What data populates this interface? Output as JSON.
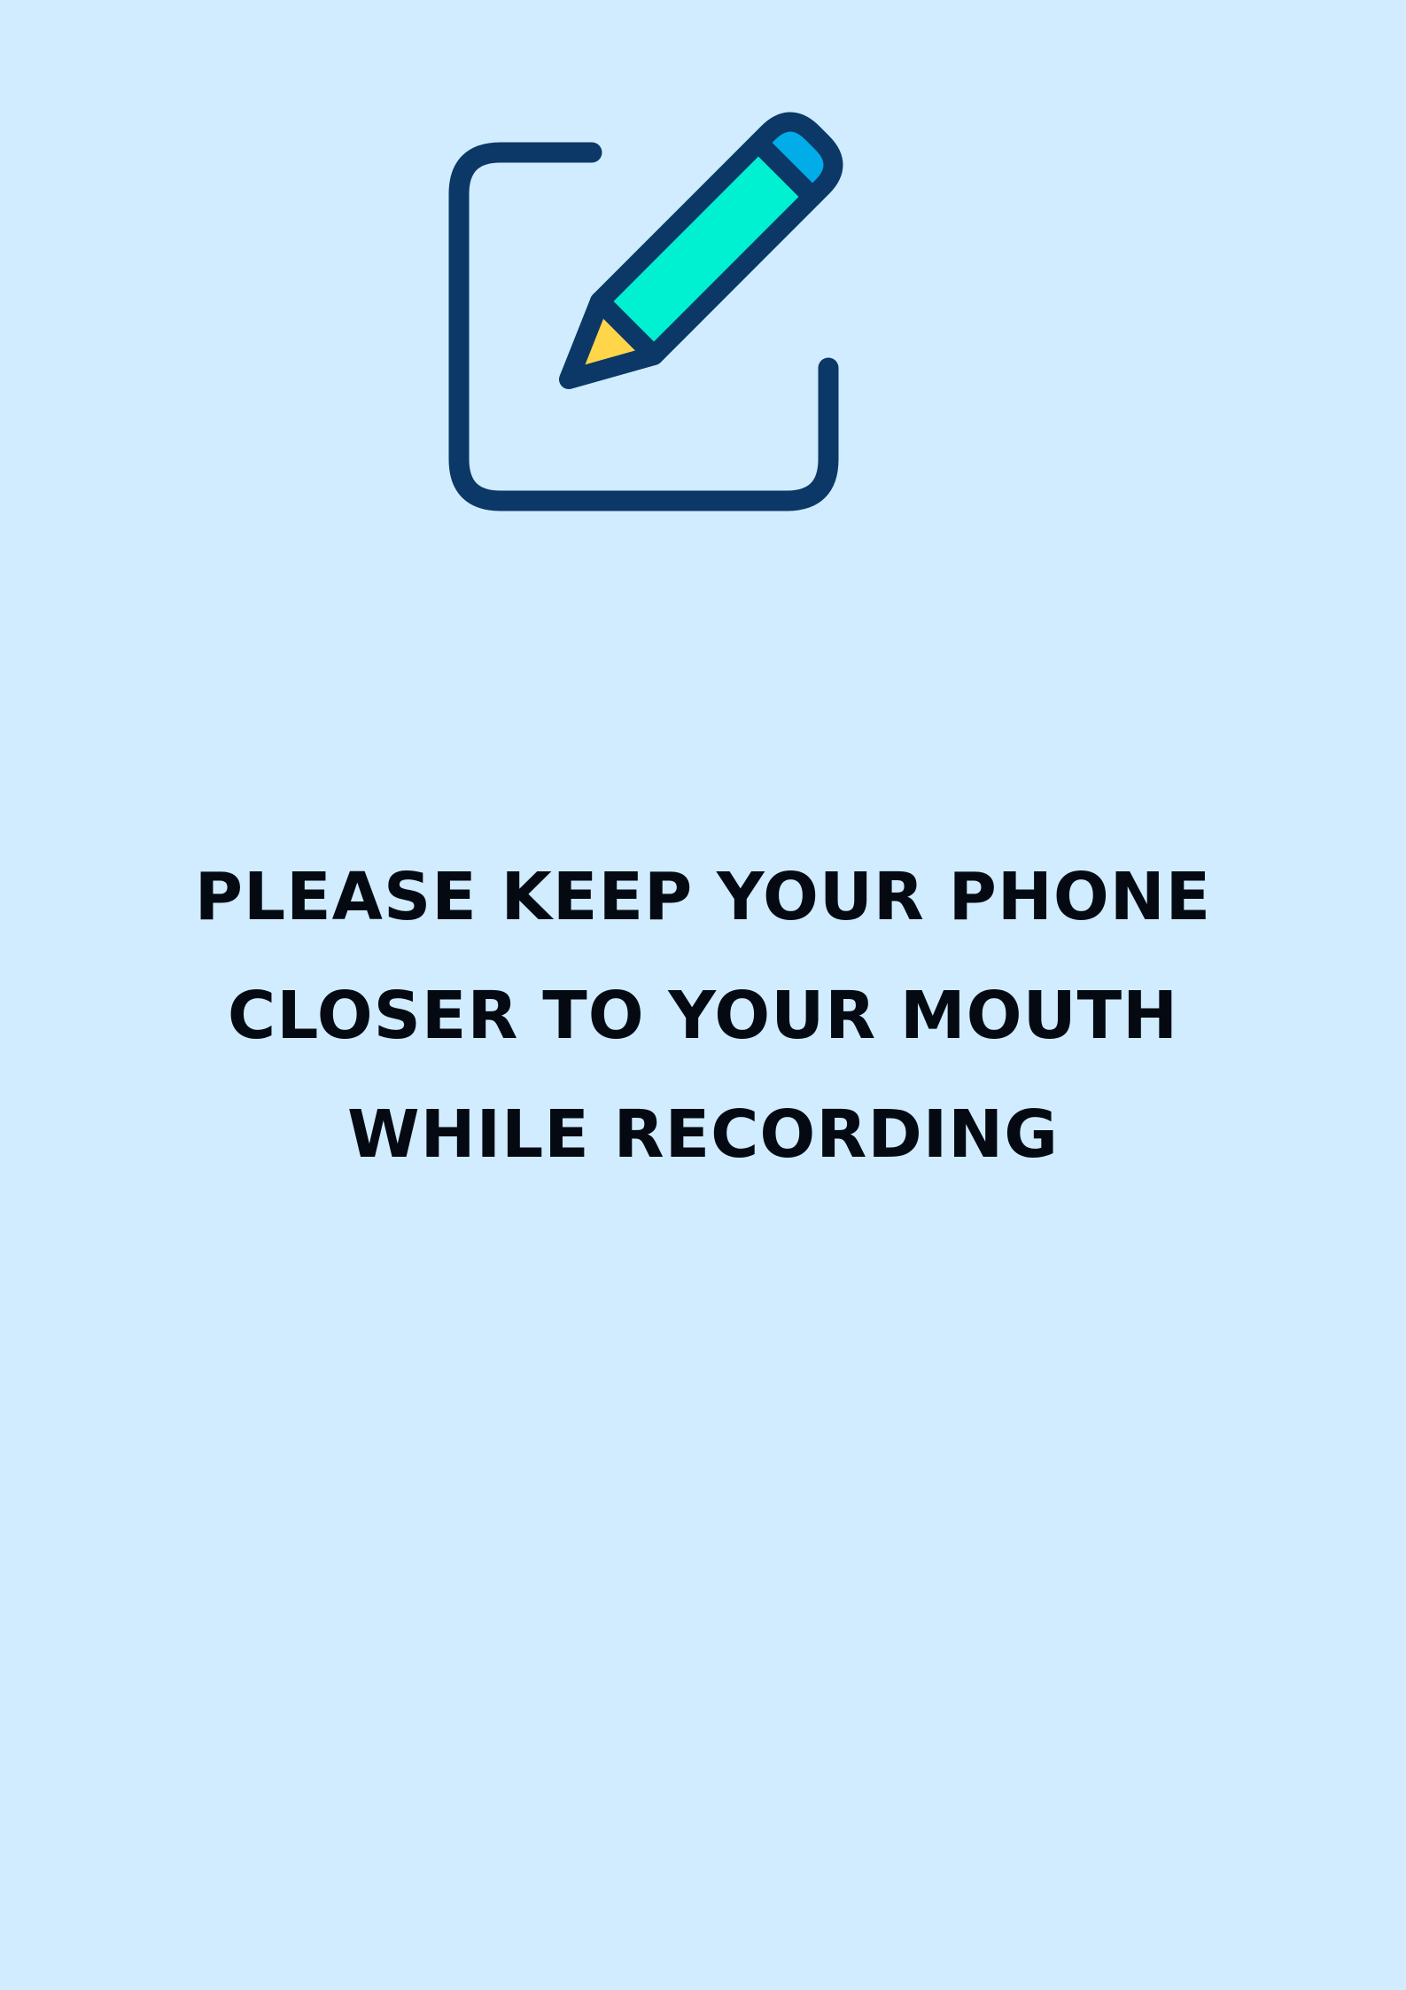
{
  "icon": {
    "name": "edit-note-icon",
    "colors": {
      "outline": "#0b3866",
      "pencil_body": "#00f0d2",
      "pencil_tip": "#ffd54a",
      "pencil_eraser": "#00ade8"
    }
  },
  "message": {
    "lines": [
      "PLEASE KEEP YOUR PHONE",
      "CLOSER TO YOUR MOUTH",
      "WHILE RECORDING"
    ]
  },
  "colors": {
    "background": "#d0ecfe",
    "text": "#050a12"
  }
}
